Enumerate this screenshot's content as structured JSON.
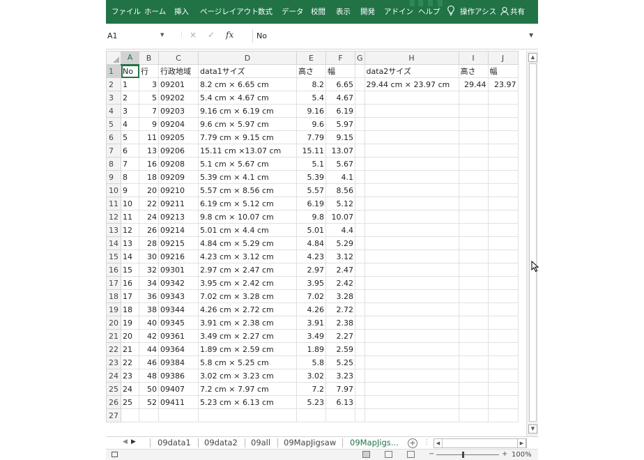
{
  "ribbon": {
    "tabs": [
      "ファイル",
      "ホーム",
      "挿入",
      "ページレイアウト",
      "数式",
      "データ",
      "校閲",
      "表示",
      "開発",
      "アドイン",
      "ヘルプ"
    ],
    "tell_me_icon": "lightbulb-icon",
    "tell_me": "操作アシス",
    "share_icon": "person-icon",
    "share": "共有",
    "background": "#217346"
  },
  "formula_bar": {
    "name_box": "A1",
    "cancel_icon": "×",
    "enter_icon": "✓",
    "fx_icon": "fx",
    "value": "No"
  },
  "grid": {
    "columns": [
      "A",
      "B",
      "C",
      "D",
      "E",
      "F",
      "G",
      "H",
      "I",
      "J"
    ],
    "header": [
      "No",
      "行",
      "行政地域",
      "data1サイズ",
      "高さ",
      "幅",
      "",
      "data2サイズ",
      "高さ",
      "幅"
    ],
    "rows": [
      [
        "1",
        "3",
        "09201",
        "8.2 cm × 6.65 cm",
        "8.2",
        "6.65",
        "",
        "29.44 cm × 23.97 cm",
        "29.44",
        "23.97"
      ],
      [
        "2",
        "5",
        "09202",
        "5.4 cm × 4.67 cm",
        "5.4",
        "4.67",
        "",
        "",
        "",
        ""
      ],
      [
        "3",
        "7",
        "09203",
        "9.16 cm × 6.19 cm",
        "9.16",
        "6.19",
        "",
        "",
        "",
        ""
      ],
      [
        "4",
        "9",
        "09204",
        "9.6 cm × 5.97 cm",
        "9.6",
        "5.97",
        "",
        "",
        "",
        ""
      ],
      [
        "5",
        "11",
        "09205",
        "7.79 cm × 9.15 cm",
        "7.79",
        "9.15",
        "",
        "",
        "",
        ""
      ],
      [
        "6",
        "13",
        "09206",
        "15.11 cm ×13.07  cm",
        "15.11",
        "13.07",
        "",
        "",
        "",
        ""
      ],
      [
        "7",
        "16",
        "09208",
        "5.1 cm × 5.67 cm",
        "5.1",
        "5.67",
        "",
        "",
        "",
        ""
      ],
      [
        "8",
        "18",
        "09209",
        "5.39 cm × 4.1 cm",
        "5.39",
        "4.1",
        "",
        "",
        "",
        ""
      ],
      [
        "9",
        "20",
        "09210",
        "5.57 cm × 8.56 cm",
        "5.57",
        "8.56",
        "",
        "",
        "",
        ""
      ],
      [
        "10",
        "22",
        "09211",
        "6.19 cm × 5.12 cm",
        "6.19",
        "5.12",
        "",
        "",
        "",
        ""
      ],
      [
        "11",
        "24",
        "09213",
        "9.8 cm × 10.07 cm",
        "9.8",
        "10.07",
        "",
        "",
        "",
        ""
      ],
      [
        "12",
        "26",
        "09214",
        "5.01 cm × 4.4 cm",
        "5.01",
        "4.4",
        "",
        "",
        "",
        ""
      ],
      [
        "13",
        "28",
        "09215",
        "4.84 cm × 5.29 cm",
        "4.84",
        "5.29",
        "",
        "",
        "",
        ""
      ],
      [
        "14",
        "30",
        "09216",
        "4.23 cm × 3.12 cm",
        "4.23",
        "3.12",
        "",
        "",
        "",
        ""
      ],
      [
        "15",
        "32",
        "09301",
        "2.97 cm × 2.47 cm",
        "2.97",
        "2.47",
        "",
        "",
        "",
        ""
      ],
      [
        "16",
        "34",
        "09342",
        "3.95 cm × 2.42 cm",
        "3.95",
        "2.42",
        "",
        "",
        "",
        ""
      ],
      [
        "17",
        "36",
        "09343",
        "7.02 cm × 3.28 cm",
        "7.02",
        "3.28",
        "",
        "",
        "",
        ""
      ],
      [
        "18",
        "38",
        "09344",
        "4.26 cm × 2.72 cm",
        "4.26",
        "2.72",
        "",
        "",
        "",
        ""
      ],
      [
        "19",
        "40",
        "09345",
        "3.91 cm × 2.38 cm",
        "3.91",
        "2.38",
        "",
        "",
        "",
        ""
      ],
      [
        "20",
        "42",
        "09361",
        "3.49 cm × 2.27 cm",
        "3.49",
        "2.27",
        "",
        "",
        "",
        ""
      ],
      [
        "21",
        "44",
        "09364",
        "1.89 cm × 2.59 cm",
        "1.89",
        "2.59",
        "",
        "",
        "",
        ""
      ],
      [
        "22",
        "46",
        "09384",
        "5.8 cm × 5.25 cm",
        "5.8",
        "5.25",
        "",
        "",
        "",
        ""
      ],
      [
        "23",
        "48",
        "09386",
        "3.02 cm × 3.23 cm",
        "3.02",
        "3.23",
        "",
        "",
        "",
        ""
      ],
      [
        "24",
        "50",
        "09407",
        "7.2 cm × 7.97 cm",
        "7.2",
        "7.97",
        "",
        "",
        "",
        ""
      ],
      [
        "25",
        "52",
        "09411",
        "5.23 cm × 6.13 cm",
        "5.23",
        "6.13",
        "",
        "",
        "",
        ""
      ]
    ],
    "extra_empty_row": "27",
    "active_cell": "A1"
  },
  "sheet_tabs": {
    "tabs": [
      "09data1",
      "09data2",
      "09all",
      "09MapJigsaw",
      "09MapJigs..."
    ],
    "active_index": 4,
    "add_icon": "+"
  },
  "status_bar": {
    "zoom": "100%",
    "zoom_minus": "−",
    "zoom_plus": "+"
  },
  "colors": {
    "accent": "#217346",
    "header_bg": "#f3f3f3",
    "gridline": "#e1e1e1"
  }
}
